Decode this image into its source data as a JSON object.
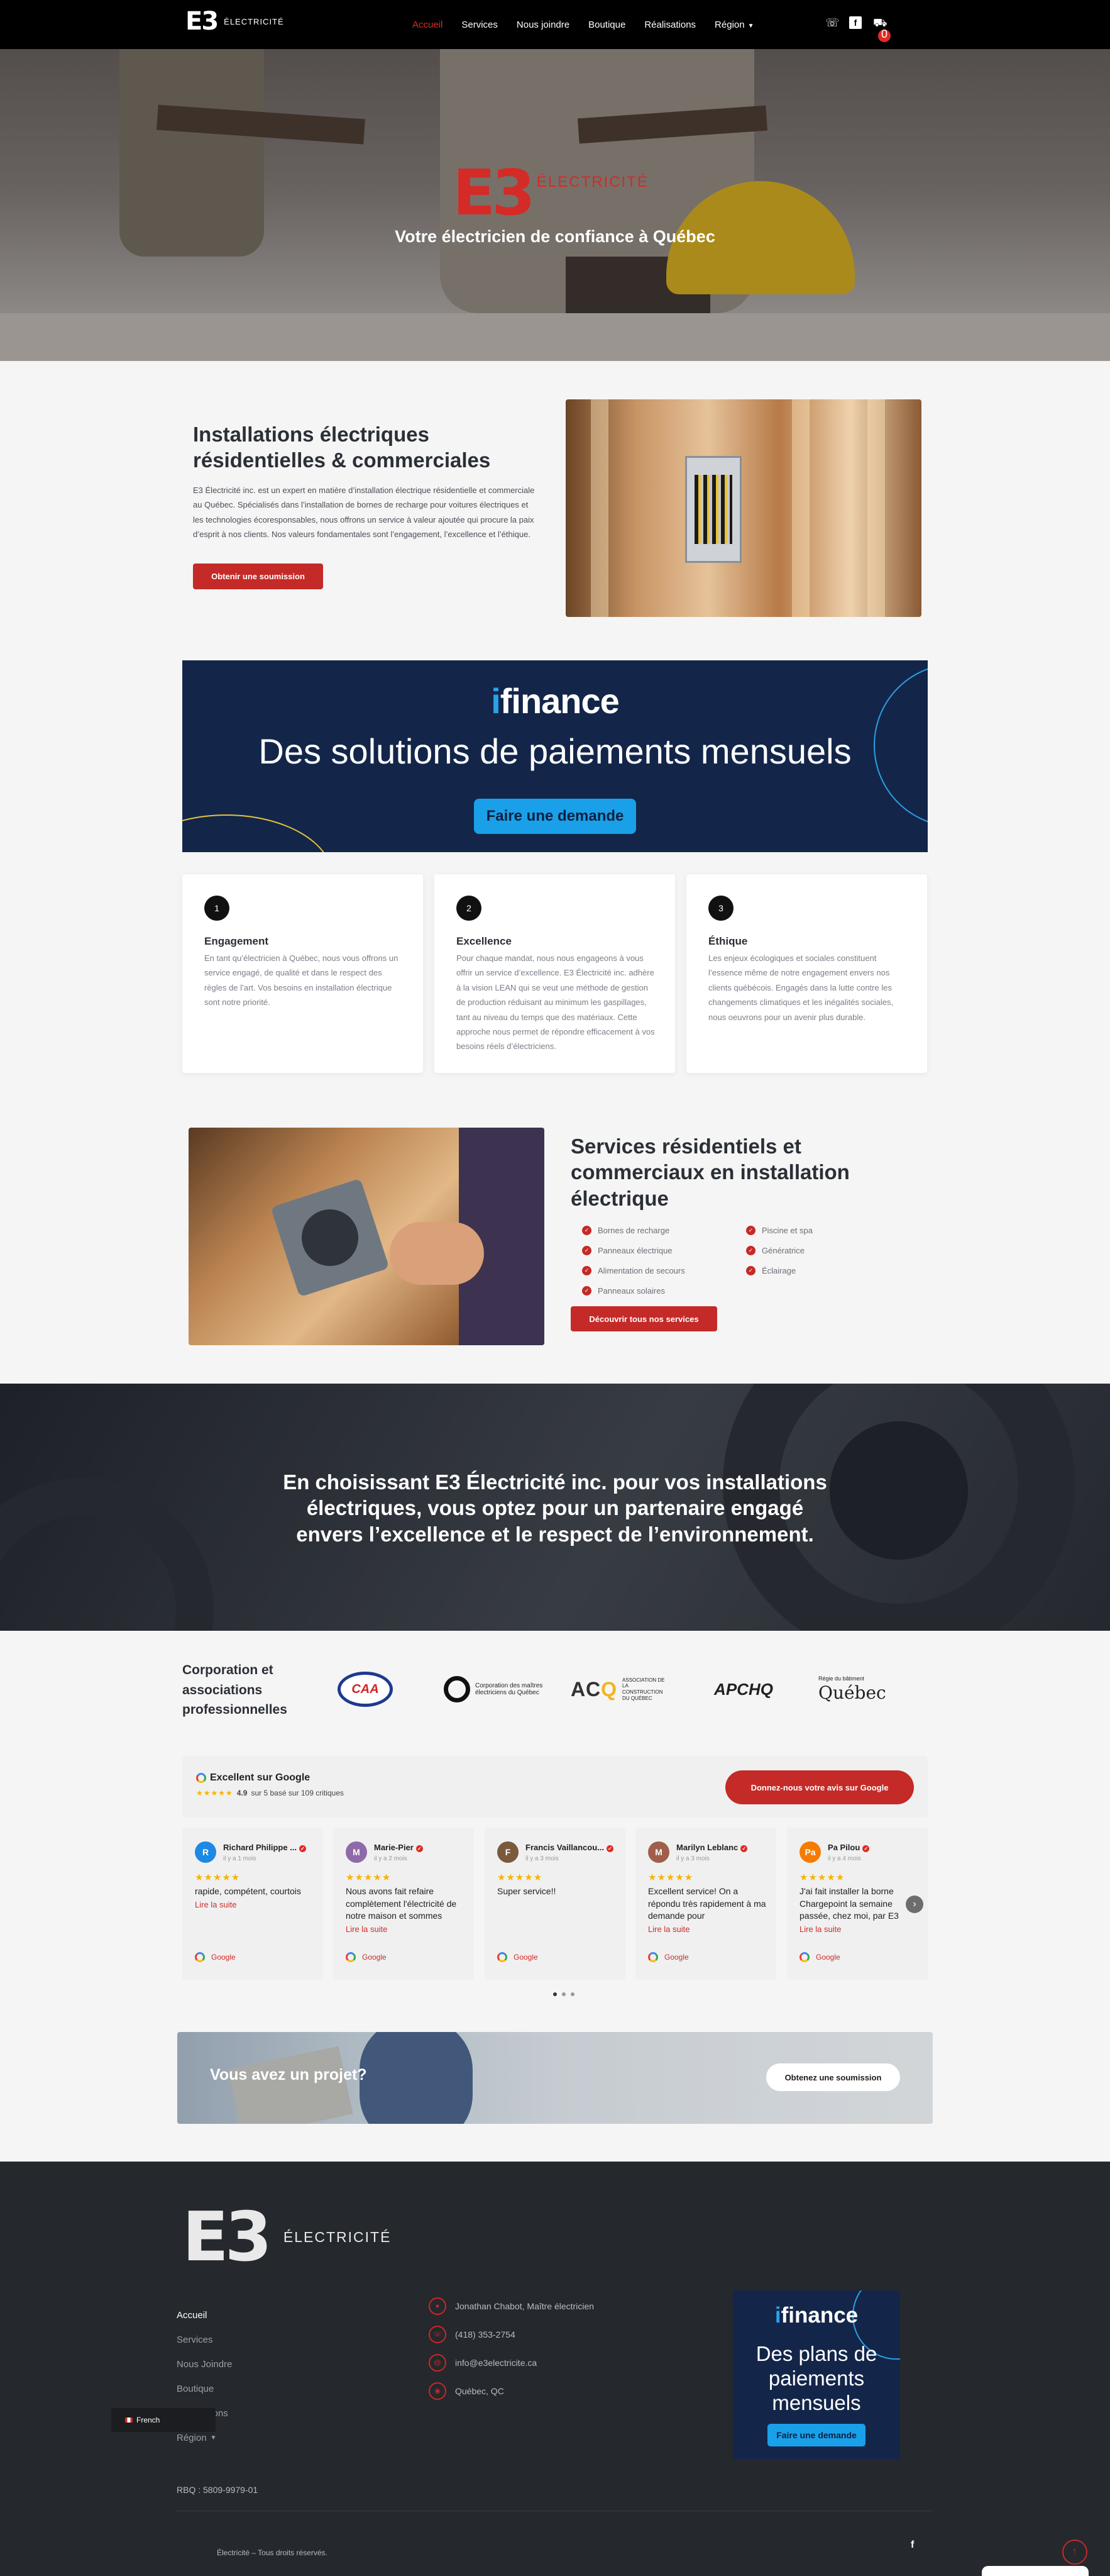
{
  "nav": {
    "logo_mark": "E3",
    "logo_word": "ÉLECTRICITÉ",
    "items": [
      {
        "label": "Accueil",
        "active": true
      },
      {
        "label": "Services"
      },
      {
        "label": "Nous joindre"
      },
      {
        "label": "Boutique"
      },
      {
        "label": "Réalisations"
      },
      {
        "label": "Région",
        "dropdown": true
      }
    ],
    "cart_count": "0",
    "icons": [
      "phone-icon",
      "facebook-icon",
      "cart-icon"
    ]
  },
  "hero": {
    "logo_mark": "E3",
    "logo_word": "ÉLECTRICITÉ",
    "tagline": "Votre électricien de confiance à Québec"
  },
  "intro": {
    "title": "Installations électriques résidentielles & commerciales",
    "text": "E3 Électricité inc. est un expert en matière d’installation électrique résidentielle et commerciale au Québec. Spécialisés dans l’installation de bornes de recharge pour voitures électriques et les technologies écoresponsables, nous offrons un service à valeur ajoutée qui procure la paix d’esprit à nos clients. Nos valeurs fondamentales sont l’engagement, l’excellence et l’éthique.",
    "button": "Obtenir une soumission"
  },
  "ifinance": {
    "logo_i": "i",
    "logo_rest": "finance",
    "headline": "Des solutions de paiements mensuels",
    "button": "Faire une demande"
  },
  "values": [
    {
      "num": "1",
      "title": "Engagement",
      "text": "En tant qu’électricien à Québec, nous vous offrons un service engagé, de qualité et dans le respect des règles de l’art. Vos besoins en installation électrique sont notre priorité."
    },
    {
      "num": "2",
      "title": "Excellence",
      "text": "Pour chaque mandat, nous nous engageons à vous offrir un service d’excellence. E3 Électricité inc. adhère à la vision LEAN qui se veut une méthode de gestion de production réduisant au minimum les gaspillages, tant au niveau du temps que des matériaux. Cette approche nous permet de répondre efficacement à vos besoins réels d’électriciens."
    },
    {
      "num": "3",
      "title": "Éthique",
      "text": "Les enjeux écologiques et sociales constituent l’essence même de notre engagement envers nos clients québécois. Engagés dans la lutte contre les changements climatiques et les inégalités sociales, nous oeuvrons pour un avenir plus durable."
    }
  ],
  "services": {
    "title": "Services résidentiels et commerciaux en installation électrique",
    "col1": [
      "Bornes de recharge",
      "Panneaux électrique",
      "Alimentation de secours",
      "Panneaux solaires"
    ],
    "col2": [
      "Piscine et spa",
      "Génératrice",
      "Éclairage"
    ],
    "button": "Découvrir tous nos services"
  },
  "quote": {
    "text": "En choisissant E3 Électricité inc. pour vos installations électriques, vous optez pour un partenaire engagé envers l’excellence et le respect de l’environnement."
  },
  "associations": {
    "title": "Corporation et associations professionnelles",
    "caa": "CAA",
    "cmeq": "Corporation des maîtres électriciens du Québec",
    "acq_a": "AC",
    "acq_q": "Q",
    "acq_text": "ASSOCIATION DE LA CONSTRUCTION DU QUÉBEC",
    "apchq": "APCHQ",
    "rbq_text": "Régie du bâtiment",
    "rbq_quebec": "Québec"
  },
  "reviews": {
    "heading": "Excellent sur Google",
    "score": "4.9",
    "score_text": "sur 5 basé sur 109 critiques",
    "write_button": "Donnez-nous votre avis sur Google",
    "read_more": "Lire la suite",
    "source": "Google",
    "items": [
      {
        "name": "Richard Philippe ...",
        "initial": "R",
        "color": "#1e88e5",
        "ago": "il y a 1 mois",
        "text": "rapide, compétent, courtois"
      },
      {
        "name": "Marie-Pier",
        "initial": "M",
        "color": "#8e6ba8",
        "ago": "il y a 2 mois",
        "text": "Nous avons fait refaire complètement l'électricité de notre maison et sommes"
      },
      {
        "name": "Francis Vaillancou...",
        "initial": "F",
        "color": "#7b5a3c",
        "ago": "il y a 3 mois",
        "text": "Super service!!"
      },
      {
        "name": "Marilyn Leblanc",
        "initial": "M",
        "color": "#a05f4a",
        "ago": "il y a 3 mois",
        "text": "Excellent service! On a répondu très rapidement à ma demande pour"
      },
      {
        "name": "Pa Pilou",
        "initial": "Pa",
        "color": "#f57c00",
        "ago": "il y a 4 mois",
        "text": "J'ai fait installer la borne Chargepoint la semaine passée, chez moi, par E3"
      }
    ]
  },
  "project": {
    "title": "Vous avez un projet?",
    "button": "Obtenez une soumission"
  },
  "footer": {
    "logo_mark": "E3",
    "logo_word": "ÉLECTRICITÉ",
    "menu": [
      {
        "label": "Accueil",
        "active": true
      },
      {
        "label": "Services"
      },
      {
        "label": "Nous Joindre"
      },
      {
        "label": "Boutique"
      },
      {
        "label": "Réalisations"
      },
      {
        "label": "Région",
        "dropdown": true
      }
    ],
    "contact": [
      {
        "icon": "user-icon",
        "glyph": "●",
        "text": "Jonathan Chabot, Maître électricien"
      },
      {
        "icon": "phone-icon",
        "glyph": "☏",
        "text": "(418) 353-2754"
      },
      {
        "icon": "email-icon",
        "glyph": "@",
        "text": "info@e3electricite.ca"
      },
      {
        "icon": "location-icon",
        "glyph": "◉",
        "text": "Québec, QC"
      }
    ],
    "ifinance_logo_i": "i",
    "ifinance_logo_rest": "finance",
    "ifinance_headline": "Des plans de paiements mensuels",
    "ifinance_button": "Faire une demande",
    "rbq": "RBQ : 5809-9979-01",
    "copyright": "Électricité – Tous droits réservés.",
    "facebook": "f",
    "language": "French"
  },
  "colors": {
    "brand_red": "#c42a27",
    "dark_navy": "#13264a",
    "ifinance_blue": "#1aa0e8",
    "footer_bg": "#25282d"
  }
}
